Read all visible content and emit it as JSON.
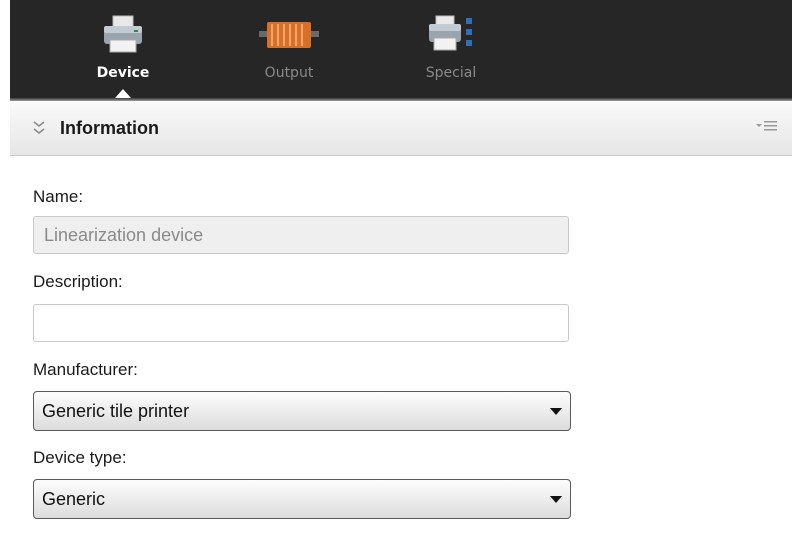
{
  "toolbar": {
    "tabs": [
      {
        "label": "Device",
        "icon": "printer-icon",
        "active": true
      },
      {
        "label": "Output",
        "icon": "output-icon",
        "active": false
      },
      {
        "label": "Special",
        "icon": "special-printer-icon",
        "active": false
      }
    ]
  },
  "panel": {
    "title": "Information",
    "collapse_icon": "double-chevron-down-icon",
    "menu_icon": "panel-menu-icon"
  },
  "form": {
    "name_label": "Name:",
    "name_value": "Linearization device",
    "description_label": "Description:",
    "description_value": "",
    "manufacturer_label": "Manufacturer:",
    "manufacturer_value": "Generic tile printer",
    "device_type_label": "Device type:",
    "device_type_value": "Generic"
  },
  "colors": {
    "toolbar_bg": "#262626",
    "output_icon": "#d9702a",
    "active_text": "#ffffff",
    "inactive_text": "#8a8a8a"
  }
}
